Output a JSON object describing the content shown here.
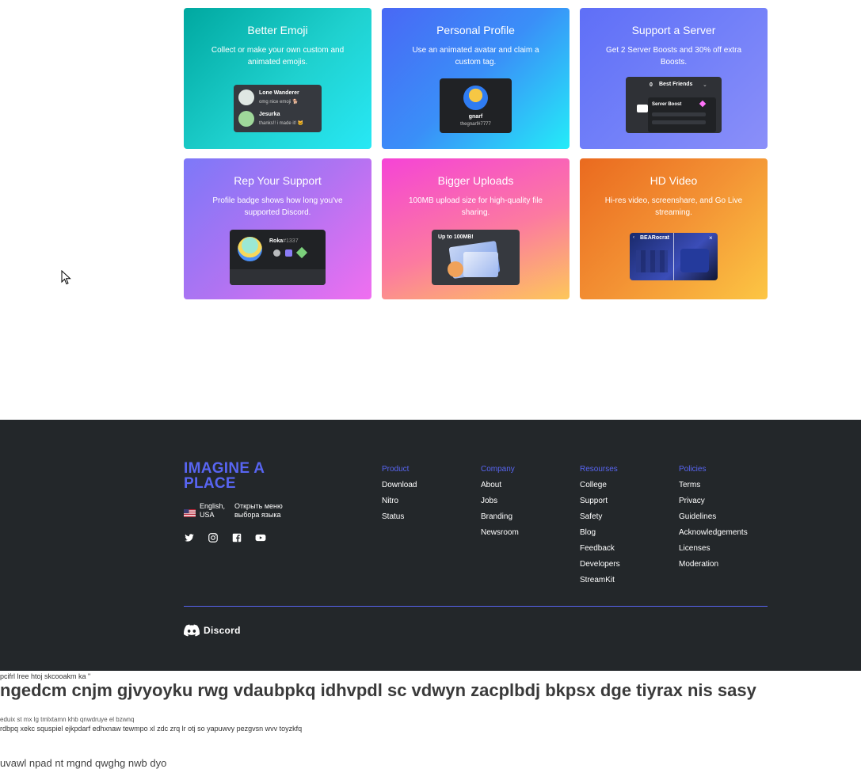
{
  "cards": [
    {
      "title": "Better Emoji",
      "desc": "Collect or make your own custom and animated emojis."
    },
    {
      "title": "Personal Profile",
      "desc": "Use an animated avatar and claim a custom tag."
    },
    {
      "title": "Support a Server",
      "desc": "Get 2 Server Boosts and 30% off extra Boosts."
    },
    {
      "title": "Rep Your Support",
      "desc": "Profile badge shows how long you've supported Discord."
    },
    {
      "title": "Bigger Uploads",
      "desc": "100MB upload size for high-quality file sharing."
    },
    {
      "title": "HD Video",
      "desc": "Hi-res video, screenshare, and Go Live streaming."
    }
  ],
  "mock": {
    "emoji": {
      "user1": "Lone Wanderer",
      "msg1": "omg nice emoji 🐕",
      "user2": "Jesurka",
      "msg2": "thanks!! i made it! 🐱"
    },
    "profile": {
      "name": "gnarf",
      "tag": "thegnarf#7777"
    },
    "server": {
      "count": "0",
      "name": "Best Friends",
      "boost": "Server Boost"
    },
    "support": {
      "name": "Roka",
      "tag": "#1337"
    },
    "upload": {
      "label": "Up to 100MB!"
    },
    "video": {
      "name": "BEARocrat"
    }
  },
  "footer": {
    "brand_line1": "IMAGINE A",
    "brand_line2": "PLACE",
    "lang_label_1": "English,",
    "lang_label_2": "USA",
    "lang_menu_1": "Открыть меню",
    "lang_menu_2": "выбора языка",
    "logo_text": "Discord",
    "columns": [
      {
        "heading": "Product",
        "links": [
          "Download",
          "Nitro",
          "Status"
        ]
      },
      {
        "heading": "Company",
        "links": [
          "About",
          "Jobs",
          "Branding",
          "Newsroom"
        ]
      },
      {
        "heading": "Resourses",
        "links": [
          "College",
          "Support",
          "Safety",
          "Blog",
          "Feedback",
          "Developers",
          "StreamKit"
        ]
      },
      {
        "heading": "Policies",
        "links": [
          "Terms",
          "Privacy",
          "Guidelines",
          "Acknowledgements",
          "Licenses",
          "Moderation"
        ]
      }
    ],
    "social_icons": [
      "twitter-icon",
      "instagram-icon",
      "facebook-icon",
      "youtube-icon"
    ]
  },
  "noise": {
    "line1": "pcifrl lree htoj skcooakm ka \"",
    "heading": "ngedcm cnjm gjvyoyku rwg vdaubpkq idhvpdl sc vdwyn zacplbdj bkpsx dge tiyrax nis sasy",
    "line2": "eduix st mx lg tmlxtamn khb qnwdruye el bzwnq",
    "line3": "rdbpq xekc squspiel ejkpdarf edhxnaw tewmpo xl zdc zrq lr otj so yapuwvy pezgvsn wvv toyzkfq",
    "line4": "uvawl npad nt mgnd qwghg nwb dyo"
  }
}
